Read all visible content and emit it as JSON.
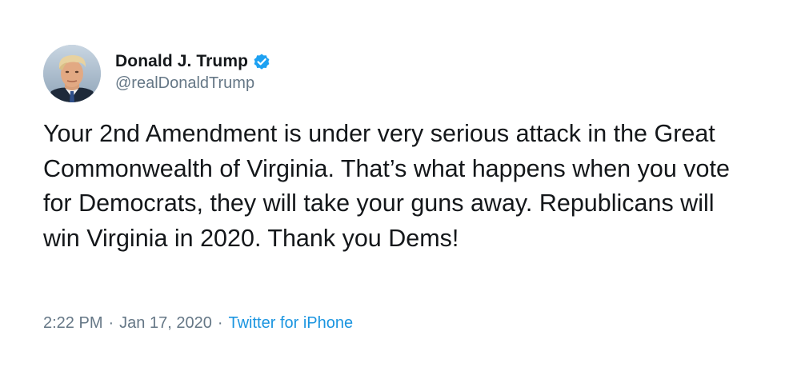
{
  "user": {
    "display_name": "Donald J. Trump",
    "handle": "@realDonaldTrump",
    "verified": true,
    "avatar_icon": "profile-photo-avatar"
  },
  "tweet": {
    "text": "Your 2nd Amendment is under very serious attack in the Great Commonwealth of Virginia. That’s what happens when you vote for Democrats, they will take your guns away. Republicans will win Virginia in 2020. Thank you Dems!",
    "time": "2:22 PM",
    "separator": "·",
    "date": "Jan 17, 2020",
    "source": "Twitter for iPhone"
  },
  "colors": {
    "text": "#14171a",
    "secondary": "#657786",
    "link": "#1b95e0",
    "verified_badge": "#1da1f2",
    "background": "#ffffff"
  }
}
